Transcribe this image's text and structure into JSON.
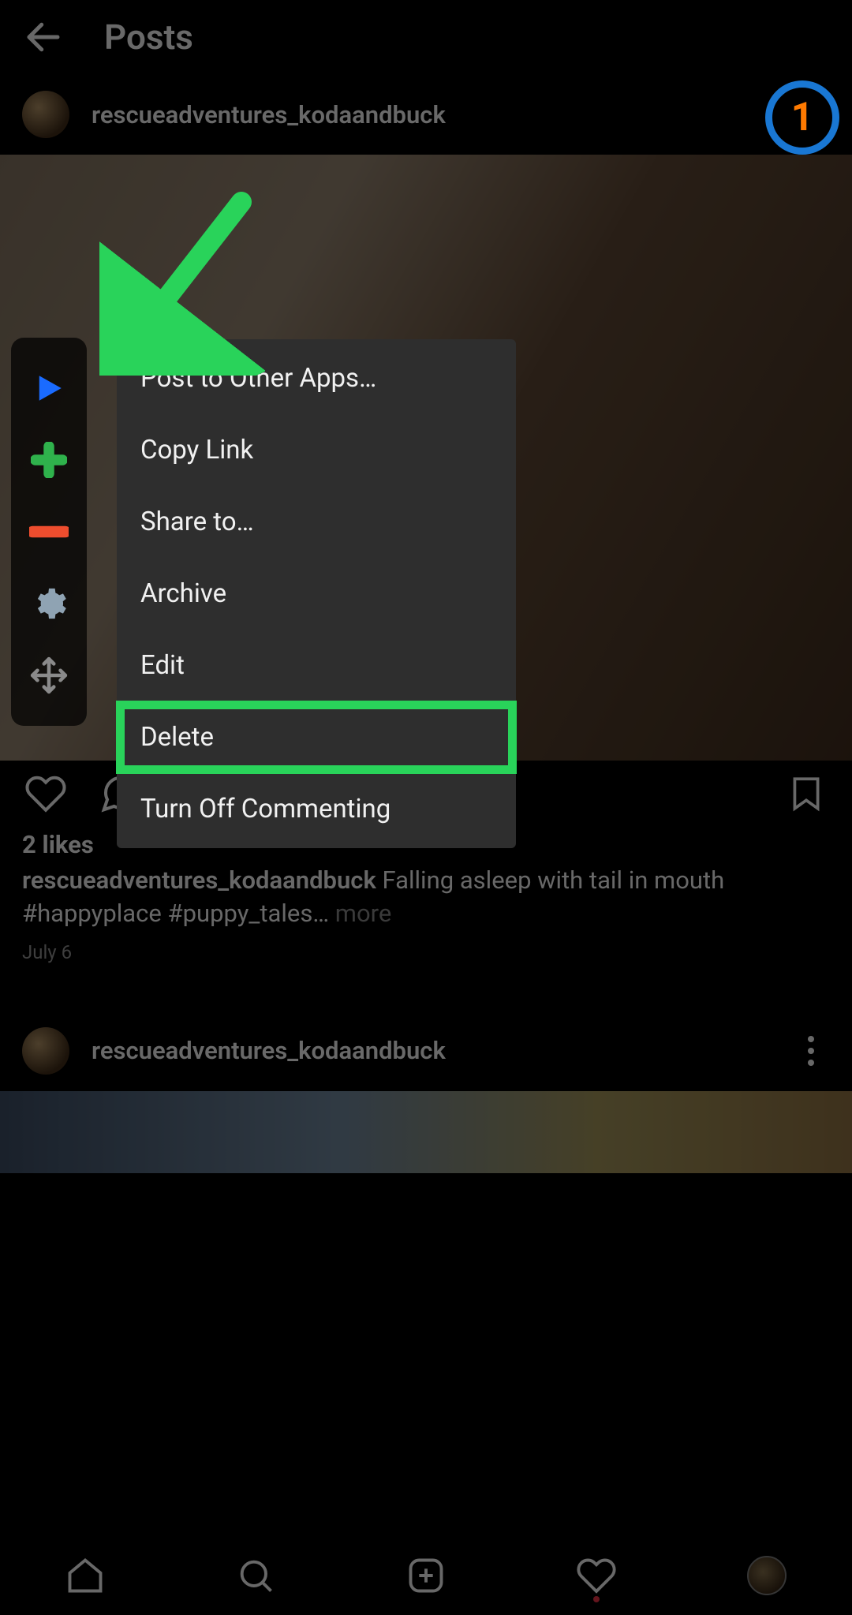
{
  "header": {
    "title": "Posts"
  },
  "annotations": {
    "step_number": "1"
  },
  "post1": {
    "username": "rescueadventures_kodaandbuck",
    "likes": "2 likes",
    "caption_user": "rescueadventures_kodaandbuck",
    "caption_text": " Falling asleep with tail in mouth #happyplace #puppy_tales… ",
    "caption_more": "more",
    "date": "July 6"
  },
  "post2": {
    "username": "rescueadventures_kodaandbuck"
  },
  "context_menu": {
    "items": [
      "Post to Other Apps…",
      "Copy Link",
      "Share to…",
      "Archive",
      "Edit",
      "Delete",
      "Turn Off Commenting"
    ],
    "highlighted_index": 5
  },
  "toolbar_icons": [
    "play-icon",
    "plus-icon",
    "minus-icon",
    "gear-icon",
    "move-icon"
  ]
}
